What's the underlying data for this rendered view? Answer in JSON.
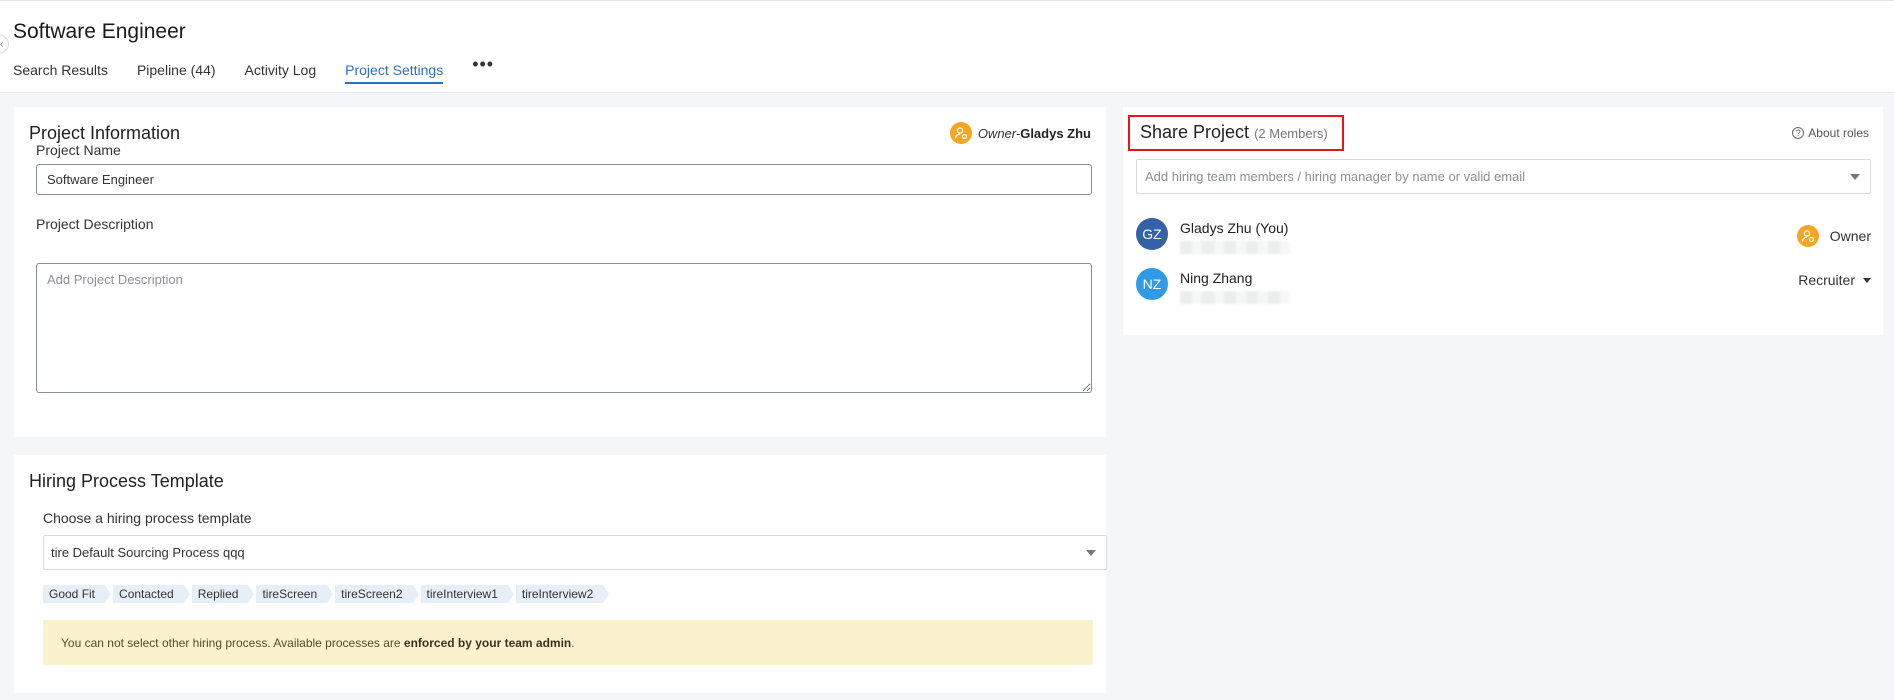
{
  "header": {
    "title": "Software Engineer",
    "tabs": [
      {
        "label": "Search Results"
      },
      {
        "label": "Pipeline (44)"
      },
      {
        "label": "Activity Log"
      },
      {
        "label": "Project Settings",
        "active": true
      }
    ],
    "more_label": "•••"
  },
  "project_info": {
    "title": "Project Information",
    "owner_role": "Owner-",
    "owner_name": "Gladys Zhu",
    "name_label": "Project Name",
    "name_value": "Software Engineer",
    "description_label": "Project Description",
    "description_placeholder": "Add Project Description"
  },
  "hiring": {
    "title": "Hiring Process Template",
    "choose_label": "Choose a hiring process template",
    "selected": "tire Default Sourcing Process qqq",
    "stages": [
      "Good Fit",
      "Contacted",
      "Replied",
      "tireScreen",
      "tireScreen2",
      "tireInterview1",
      "tireInterview2"
    ],
    "notice_text": "You can not select other hiring process. Available processes are ",
    "notice_bold": "enforced by your team admin",
    "notice_end": "."
  },
  "share": {
    "title": "Share Project",
    "count": "(2 Members)",
    "about_roles": "About roles",
    "input_placeholder": "Add hiring team members / hiring manager by name or valid email",
    "members": [
      {
        "initials": "GZ",
        "name": "Gladys Zhu (You)",
        "role": "Owner",
        "color": "#3461a8"
      },
      {
        "initials": "NZ",
        "name": "Ning Zhang",
        "role": "Recruiter",
        "color": "#2f9be8"
      }
    ]
  },
  "colors": {
    "accent": "#2f6fc2",
    "owner_badge": "#f6a623",
    "highlight_border": "#e8131b",
    "notice_bg": "#fcf1cd"
  }
}
